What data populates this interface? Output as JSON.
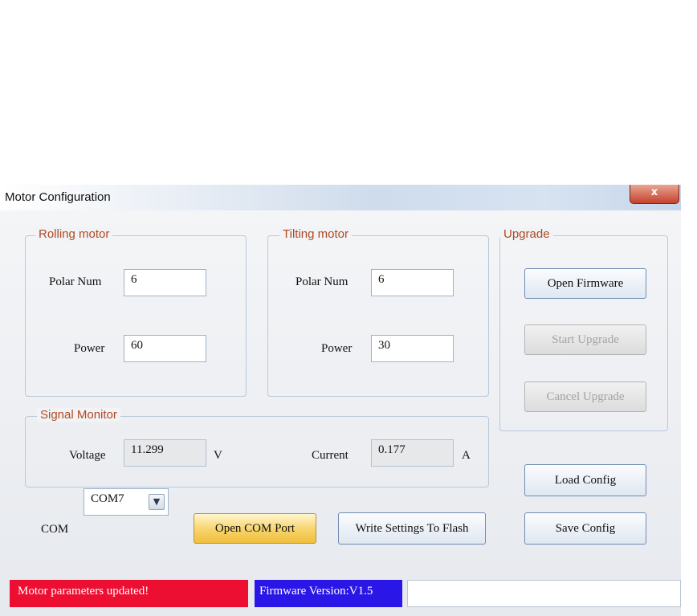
{
  "window": {
    "title": "Motor Configuration",
    "close_glyph": "x"
  },
  "rolling": {
    "title": "Rolling motor",
    "polar_label": "Polar Num",
    "polar_value": "6",
    "power_label": "Power",
    "power_value": "60"
  },
  "tilting": {
    "title": "Tilting motor",
    "polar_label": "Polar Num",
    "polar_value": "6",
    "power_label": "Power",
    "power_value": "30"
  },
  "upgrade": {
    "title": "Upgrade",
    "open_label": "Open Firmware",
    "start_label": "Start Upgrade",
    "cancel_label": "Cancel Upgrade"
  },
  "signal": {
    "title": "Signal Monitor",
    "voltage_label": "Voltage",
    "voltage_value": "11.299",
    "voltage_unit": "V",
    "current_label": "Current",
    "current_value": "0.177",
    "current_unit": "A"
  },
  "config": {
    "load_label": "Load Config",
    "save_label": "Save Config"
  },
  "com": {
    "label": "COM",
    "selected": "COM7",
    "open_label": "Open COM Port",
    "write_label": "Write Settings To Flash"
  },
  "status": {
    "message": "Motor parameters updated!",
    "firmware": "Firmware Version:V1.5",
    "extra": ""
  },
  "colors": {
    "status_error": "#ec0f32",
    "status_info": "#2a16e6",
    "group_label": "#b1491f"
  }
}
